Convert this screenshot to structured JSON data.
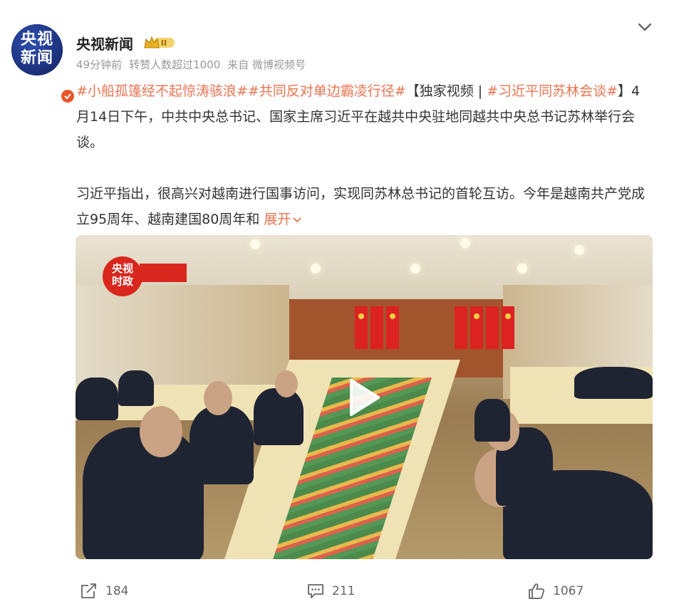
{
  "author": {
    "avatar_line1": "央视",
    "avatar_line2": "新闻",
    "name": "央视新闻",
    "level_badge": "II"
  },
  "meta": {
    "time": "49分钟前",
    "reposts_note": "转赞人数超过1000",
    "source": "来自 微博视频号"
  },
  "post": {
    "tag1": "#小船孤篷经不起惊涛骇浪#",
    "tag2": "#共同反对单边霸凌行径#",
    "label": "【独家视频 | ",
    "tag3a": "#习近平同苏林会谈",
    "tag3b": "#",
    "text1": "】4月14日下午，中共中央总书记、国家主席习近平在越共中央驻地同越共中央总书记苏林举行会谈。",
    "text2": "习近平指出，很高兴对越南进行国事访问，实现同苏林总书记的首轮互访。今年是越南共产党成立95周年、越南建国80周年和",
    "expand": "展开"
  },
  "video": {
    "logo_line1": "央视",
    "logo_line2": "时政"
  },
  "actions": {
    "reposts": "184",
    "comments": "211",
    "likes": "1067"
  },
  "colors": {
    "hashtag": "#eb7350",
    "brand_blue": "#1f3a8a",
    "logo_red": "#d9271e"
  },
  "icons": [
    "chevron-down-icon",
    "repost-icon",
    "comment-icon",
    "like-icon",
    "play-icon",
    "verified-icon",
    "crown-icon"
  ]
}
